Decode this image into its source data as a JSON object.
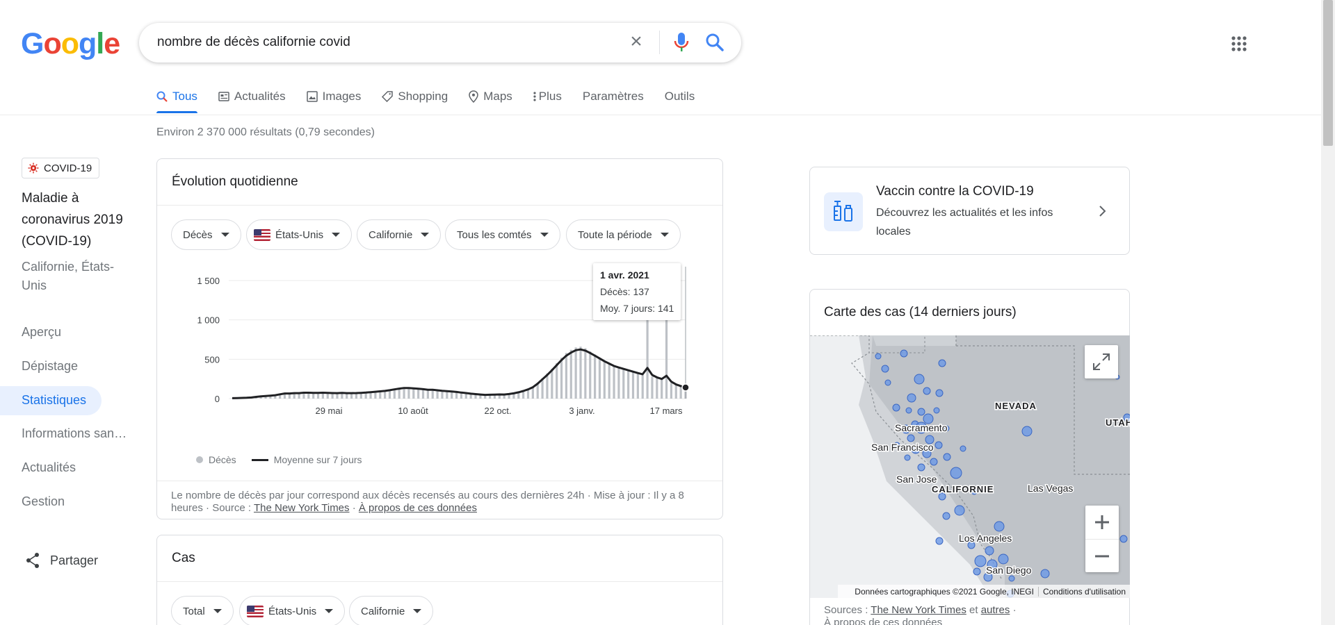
{
  "search": {
    "query": "nombre de décès californie covid"
  },
  "tabs": [
    {
      "label": "Tous",
      "icon": "search-icon",
      "active": true
    },
    {
      "label": "Actualités",
      "icon": "news-icon"
    },
    {
      "label": "Images",
      "icon": "image-icon"
    },
    {
      "label": "Shopping",
      "icon": "tag-icon"
    },
    {
      "label": "Maps",
      "icon": "pin-icon"
    },
    {
      "label": "Plus",
      "icon": "more-icon"
    },
    {
      "label": "Paramètres"
    },
    {
      "label": "Outils"
    }
  ],
  "results_stats": "Environ 2 370 000 résultats (0,79 secondes)",
  "sidebar": {
    "chip": "COVID-19",
    "disease": "Maladie à coronavirus 2019 (COVID-19)",
    "location": "Californie, États-Unis",
    "items": [
      "Aperçu",
      "Dépistage",
      "Statistiques",
      "Informations san…",
      "Actualités",
      "Gestion"
    ],
    "share": "Partager"
  },
  "daily_card": {
    "title": "Évolution quotidienne",
    "filters": [
      "Décès",
      "États-Unis",
      "Californie",
      "Tous les comtés",
      "Toute la période"
    ],
    "tooltip": {
      "date": "1 avr. 2021",
      "deaths": "Décès: 137",
      "avg": "Moy. 7 jours: 141"
    },
    "legend": {
      "deaths": "Décès",
      "avg": "Moyenne sur 7 jours"
    },
    "footnote": "Le nombre de décès par jour correspond aux décès recensés au cours des dernières 24h · Mise à jour : Il y a 8 heures · Source :",
    "source_link": "The New York Times",
    "about_link": "À propos de ces données"
  },
  "cases_card": {
    "title": "Cas",
    "filters": [
      "Total",
      "États-Unis",
      "Californie"
    ]
  },
  "vaccine_card": {
    "title": "Vaccin contre la COVID-19",
    "subtitle": "Découvrez les actualités et les infos locales"
  },
  "map_card": {
    "title": "Carte des cas (14 derniers jours)",
    "labels": [
      "NEVADA",
      "UTAH",
      "Sacramento",
      "San Francisco",
      "San Jose",
      "CALIFORNIE",
      "Las Vegas",
      "Los Angeles",
      "San Diego"
    ],
    "attribution": "Données cartographiques ©2021 Google, INEGI",
    "terms": "Conditions d'utilisation",
    "sources_prefix": "Sources :",
    "sources_link1": "The New York Times",
    "sources_and": "et",
    "sources_link2": "autres",
    "about": "À propos de ces données"
  },
  "chart_data": {
    "type": "bar",
    "title": "",
    "yticks": [
      "0",
      "500",
      "1 000",
      "1 500"
    ],
    "ylim": [
      0,
      1500
    ],
    "xticks": [
      "29 mai",
      "10 août",
      "22 oct.",
      "3 janv.",
      "17 mars"
    ],
    "series": [
      {
        "name": "Décès",
        "values": [
          5,
          8,
          10,
          12,
          15,
          25,
          30,
          35,
          40,
          45,
          60,
          70,
          65,
          75,
          70,
          80,
          75,
          70,
          75,
          80,
          70,
          72,
          70,
          75,
          68,
          70,
          72,
          75,
          80,
          85,
          90,
          95,
          100,
          110,
          120,
          130,
          140,
          135,
          130,
          125,
          120,
          110,
          115,
          105,
          100,
          95,
          90,
          85,
          75,
          70,
          60,
          55,
          50,
          45,
          48,
          52,
          55,
          50,
          60,
          70,
          85,
          100,
          120,
          150,
          200,
          260,
          320,
          380,
          450,
          520,
          580,
          620,
          650,
          660,
          640,
          600,
          560,
          520,
          480,
          450,
          420,
          400,
          380,
          360,
          340,
          320,
          300,
          1080,
          280,
          260,
          240,
          1050,
          200,
          180,
          160,
          137
        ]
      },
      {
        "name": "Moyenne sur 7 jours",
        "values": [
          5,
          7,
          9,
          11,
          14,
          22,
          28,
          33,
          38,
          43,
          55,
          65,
          65,
          70,
          70,
          75,
          75,
          72,
          73,
          75,
          72,
          71,
          70,
          72,
          70,
          70,
          71,
          73,
          77,
          82,
          87,
          93,
          98,
          107,
          117,
          127,
          135,
          134,
          130,
          126,
          120,
          113,
          112,
          106,
          100,
          95,
          90,
          85,
          77,
          71,
          63,
          57,
          52,
          48,
          49,
          51,
          53,
          52,
          58,
          67,
          80,
          97,
          117,
          145,
          190,
          245,
          300,
          360,
          425,
          490,
          545,
          585,
          615,
          625,
          610,
          580,
          545,
          510,
          475,
          445,
          415,
          395,
          378,
          360,
          342,
          325,
          310,
          390,
          300,
          270,
          250,
          290,
          215,
          180,
          160,
          141
        ]
      }
    ]
  }
}
